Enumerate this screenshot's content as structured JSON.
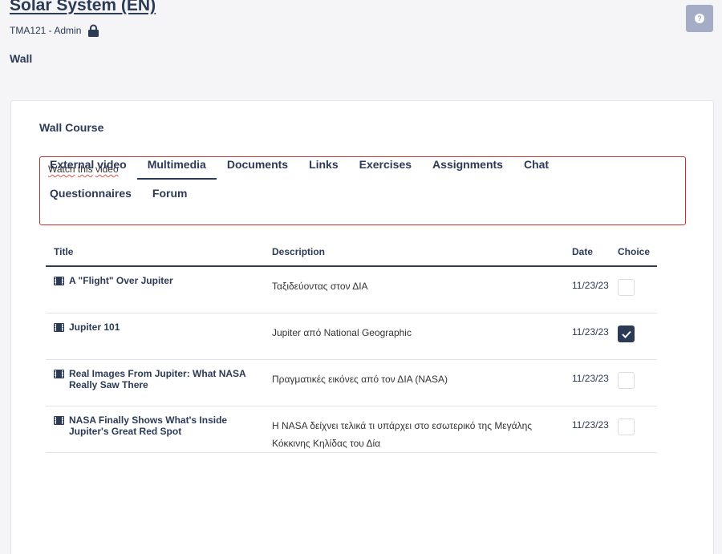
{
  "header": {
    "title": "Solar System (EN)",
    "course_code": "TMA121 - Admin",
    "section": "Wall",
    "help_icon_glyph": "?"
  },
  "card": {
    "title": "Wall Course",
    "textarea": {
      "word1": "Watch",
      "word2": "this",
      "word3": "video"
    }
  },
  "tabs": {
    "row1": [
      "External video",
      "Multimedia",
      "Documents",
      "Links",
      "Exercises",
      "Assignments",
      "Chat"
    ],
    "row2": [
      "Questionnaires",
      "Forum"
    ],
    "active": "Multimedia"
  },
  "table": {
    "headers": {
      "title": "Title",
      "description": "Description",
      "date": "Date",
      "choice": "Choice"
    },
    "rows": [
      {
        "title": "A \"Flight\" Over Jupiter",
        "description": "Ταξιδεύοντας στον ΔΙΑ",
        "date": "11/23/23",
        "checked": false
      },
      {
        "title": "Jupiter 101",
        "description": "Jupiter από National Geographic",
        "date": "11/23/23",
        "checked": true
      },
      {
        "title": "Real Images From Jupiter: What NASA Really Saw There",
        "description": "Πραγματικές εικόνες από τον ΔΙΑ (NASA)",
        "date": "11/23/23",
        "checked": false
      },
      {
        "title": "NASA Finally Shows What's Inside Jupiter's Great Red Spot",
        "description": "Η NASA δείχνει τελικά τι υπάρχει στο εσωτερικό της Μεγάλης Κόκκινης Κηλίδας του Δία",
        "date": "11/23/23",
        "checked": false
      }
    ]
  },
  "colors": {
    "primary": "#2b3a55",
    "help_bg": "#a4acc6",
    "error_border": "#c9302c"
  }
}
